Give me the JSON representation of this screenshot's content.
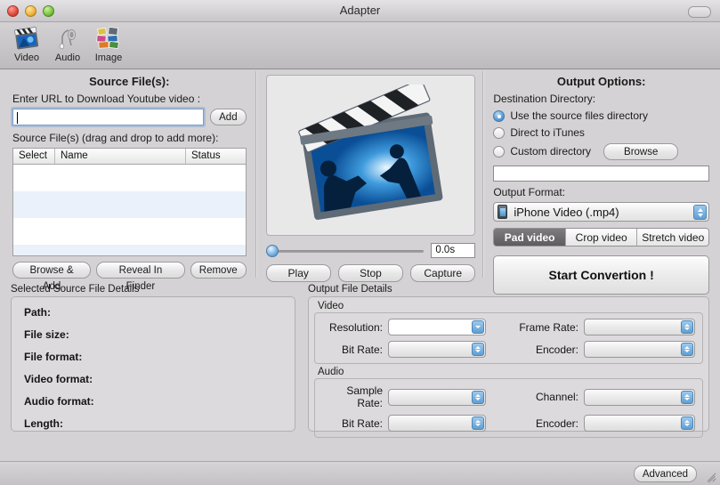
{
  "window": {
    "title": "Adapter",
    "traffic_lights": [
      "close-red",
      "minimize-yellow",
      "zoom-green"
    ],
    "toolbar_toggle": "toolbar-toggle-button"
  },
  "toolbar": {
    "items": [
      {
        "label": "Video",
        "icon": "clapperboard-icon",
        "active": true
      },
      {
        "label": "Audio",
        "icon": "earbuds-icon",
        "active": false
      },
      {
        "label": "Image",
        "icon": "photo-collage-icon",
        "active": false
      }
    ]
  },
  "source_panel": {
    "heading": "Source File(s):",
    "url_label": "Enter URL to Download Youtube video :",
    "url_value": "",
    "url_placeholder": "",
    "add_button": "Add",
    "list_label": "Source File(s) (drag and drop to add more):",
    "columns": [
      "Select",
      "Name",
      "Status"
    ],
    "rows": [],
    "buttons": [
      "Browse & Add",
      "Reveal In Finder",
      "Remove"
    ]
  },
  "preview_panel": {
    "thumbnail": "movie-clapperboard-thumbnail",
    "slider_value": 0,
    "time_value": "0.0s",
    "buttons": [
      "Play",
      "Stop",
      "Capture"
    ]
  },
  "output_panel": {
    "heading": "Output Options:",
    "destination_label": "Destination Directory:",
    "radios": [
      {
        "label": "Use the source files directory",
        "selected": true
      },
      {
        "label": "Direct to iTunes",
        "selected": false
      },
      {
        "label": "Custom directory",
        "selected": false
      }
    ],
    "browse_button": "Browse",
    "custom_dir_value": "",
    "format_label": "Output Format:",
    "format_value": "iPhone Video (.mp4)",
    "format_icon": "iphone-icon",
    "segments": [
      {
        "label": "Pad video",
        "active": true
      },
      {
        "label": "Crop video",
        "active": false
      },
      {
        "label": "Stretch video",
        "active": false
      }
    ],
    "start_button": "Start Convertion !"
  },
  "source_details": {
    "title": "Selected Source File Details",
    "fields": [
      {
        "label": "Path:",
        "value": ""
      },
      {
        "label": "File size:",
        "value": ""
      },
      {
        "label": "File format:",
        "value": ""
      },
      {
        "label": "Video format:",
        "value": ""
      },
      {
        "label": "Audio format:",
        "value": ""
      },
      {
        "label": "Length:",
        "value": ""
      }
    ]
  },
  "output_details": {
    "title": "Output File Details",
    "video": {
      "section_label": "Video",
      "fields": [
        {
          "label": "Resolution:",
          "value": "",
          "control": "combo"
        },
        {
          "label": "Frame Rate:",
          "value": "",
          "control": "stepper"
        },
        {
          "label": "Bit Rate:",
          "value": "",
          "control": "stepper"
        },
        {
          "label": "Encoder:",
          "value": "",
          "control": "stepper"
        }
      ]
    },
    "audio": {
      "section_label": "Audio",
      "fields": [
        {
          "label": "Sample Rate:",
          "value": "",
          "control": "stepper"
        },
        {
          "label": "Channel:",
          "value": "",
          "control": "stepper"
        },
        {
          "label": "Bit Rate:",
          "value": "",
          "control": "stepper"
        },
        {
          "label": "Encoder:",
          "value": "",
          "control": "stepper"
        }
      ]
    }
  },
  "statusbar": {
    "advanced_button": "Advanced",
    "resize_grip": "resize-grip-icon"
  }
}
